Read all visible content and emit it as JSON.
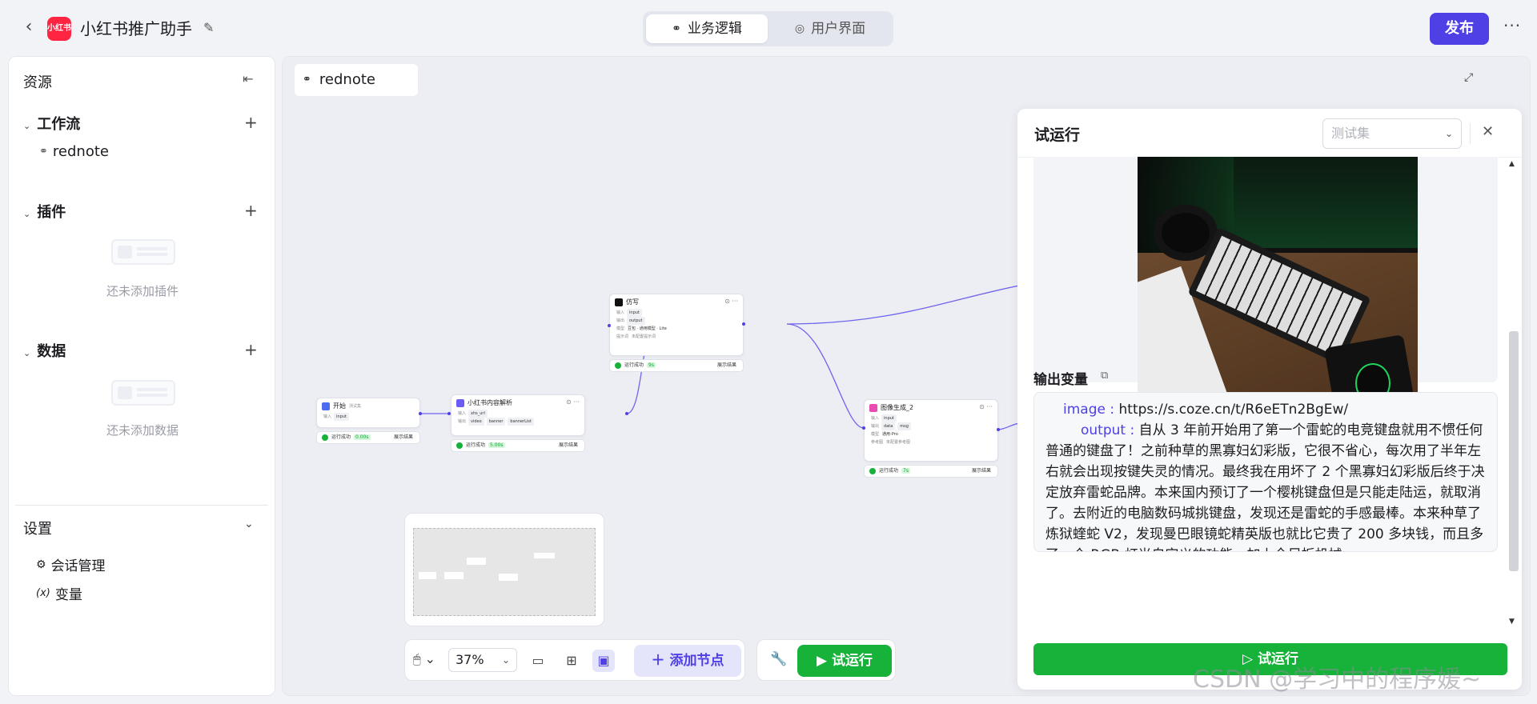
{
  "app": {
    "title": "小红书推广助手",
    "logo_text": "小红书"
  },
  "mode_tabs": [
    {
      "label": "业务逻辑",
      "active": true
    },
    {
      "label": "用户界面",
      "active": false
    }
  ],
  "header": {
    "publish_label": "发布",
    "more_label": "···"
  },
  "sidebar": {
    "title": "资源",
    "sections": {
      "workflow": {
        "label": "工作流",
        "items": [
          {
            "label": "rednote"
          }
        ]
      },
      "plugins": {
        "label": "插件",
        "empty_text": "还未添加插件"
      },
      "data": {
        "label": "数据",
        "empty_text": "还未添加数据"
      }
    },
    "settings": {
      "label": "设置",
      "items": [
        {
          "label": "会话管理"
        },
        {
          "label": "变量"
        }
      ]
    }
  },
  "canvas": {
    "tab_label": "rednote",
    "nodes": {
      "start": {
        "title": "开始",
        "badge": "测试集",
        "in_label": "输入",
        "in_value": "input",
        "run": "运行成功",
        "time": "0.00s",
        "result": "展示结果"
      },
      "parse": {
        "title": "小红书内容解析",
        "in_label": "输入",
        "in_value": "xhs_url",
        "out_label": "输出",
        "out_values": [
          "video",
          "banner",
          "bannerList"
        ],
        "run": "运行成功",
        "time": "5.00s",
        "result": "展示结果"
      },
      "rewrite": {
        "title": "仿写",
        "in_label": "输入",
        "in_value": "input",
        "out_label": "输出",
        "out_value": "output",
        "model_label": "模型",
        "model_value": "豆包 · 通用模型 · Lite",
        "prompt_label": "提示词",
        "prompt_value": "未配置提示词",
        "run": "运行成功",
        "time": "9s",
        "result": "展示结果"
      },
      "image": {
        "title": "图像生成_2",
        "in_label": "输入",
        "in_value": "input",
        "out_label": "输出",
        "out_values": [
          "data",
          "msg"
        ],
        "model_label": "模型",
        "model_value": "通用-Pro",
        "ref_label": "参考图",
        "ref_value": "未配置参考图",
        "run": "运行成功",
        "time": "7s",
        "result": "展示结果"
      }
    }
  },
  "toolbar": {
    "zoom": "37%",
    "add_node_label": "添加节点",
    "run_label": "试运行"
  },
  "panel": {
    "title": "试运行",
    "select_placeholder": "测试集",
    "output_title": "输出变量",
    "image_key": "image",
    "image_value": "https://s.coze.cn/t/R6eETn2BgEw/",
    "output_key": "output",
    "output_value": "自从 3 年前开始用了第一个雷蛇的电竞键盘就用不惯任何普通的键盘了！之前种草的黑寡妇幻彩版，它很不省心，每次用了半年左右就会出现按键失灵的情况。最终我在用坏了 2 个黑寡妇幻彩版后终于决定放弃雷蛇品牌。本来国内预订了一个樱桃键盘但是只能走陆运，就取消了。去附近的电脑数码城挑键盘，发现还是雷蛇的手感最棒。本来种草了炼狱蝰蛇 V2，发现曼巴眼镜蛇精英版也就比它贵了 200 多块钱，而且多了一个 RGB 灯光自定义的功能，加上全尺板机械",
    "run_label": "试运行"
  },
  "watermark": "CSDN @学习中的程序媛~",
  "colors": {
    "accent": "#4e40e5",
    "success": "#16b23a",
    "brand_red": "#ff2442"
  }
}
